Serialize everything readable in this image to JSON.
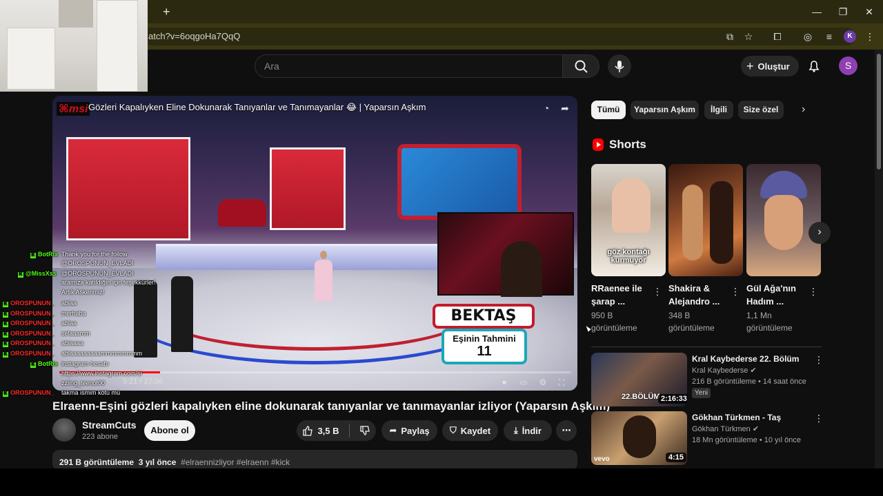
{
  "browser": {
    "url_fragment": "atch?v=6oqgoHa7QqQ",
    "profile_initial": "K",
    "new_tab_glyph": "+",
    "minimize_glyph": "—",
    "maximize_glyph": "❐",
    "close_glyph": "✕"
  },
  "header": {
    "search_placeholder": "Ara",
    "create_label": "Oluştur",
    "avatar_initial": "S"
  },
  "player": {
    "overlay_title": "Gözleri Kapalıyken Eline Dokunarak Tanıyanlar ve Tanımayanlar 😂 | Yaparsın Aşkım",
    "logo_text": "msi",
    "time": "5:21 / 27:06",
    "progress_fraction": 0.197,
    "bektas_label": "BEKTAŞ",
    "guess_label": "Eşinin Tahmini",
    "guess_value": "11",
    "chat": [
      {
        "user": "BotRix",
        "msg": "Thank you for the follow",
        "user_color": "#53fc18"
      },
      {
        "user": "",
        "msg": "@OROSPUNUN_EVLADI",
        "user_color": "#53fc18"
      },
      {
        "user": "@MissXss",
        "msg": "@OROSPUNUN_EVLADI",
        "user_color": "#53fc18"
      },
      {
        "user": "",
        "msg": "aramıza katıldığın için teşekkürler!",
        "user_color": "#53fc18"
      },
      {
        "user": "",
        "msg": "Artık Askerimiz!",
        "user_color": "#53fc18"
      },
      {
        "user": "OROSPUNUN_",
        "msg": "ablaa",
        "user_color": "#ff2a2a"
      },
      {
        "user": "OROSPUNUN_",
        "msg": "merhaba",
        "user_color": "#ff2a2a"
      },
      {
        "user": "OROSPUNUN_",
        "msg": "ablaa",
        "user_color": "#ff2a2a"
      },
      {
        "user": "OROSPUNUN_",
        "msg": "selaaamm",
        "user_color": "#ff2a2a"
      },
      {
        "user": "OROSPUNUN_",
        "msg": "ablaaaa",
        "user_color": "#ff2a2a"
      },
      {
        "user": "OROSPUNUN_",
        "msg": "ablaaaaaaaaammmmmmmm",
        "user_color": "#ff2a2a"
      },
      {
        "user": "BotRix",
        "msg": "instagram hesabı",
        "user_color": "#53fc18"
      },
      {
        "user": "",
        "msg": "https://www.instagram.com/si",
        "user_color": "#53fc18"
      },
      {
        "user": "",
        "msg": "zzling_teenot00",
        "user_color": "#53fc18"
      },
      {
        "user": "OROSPUNUN_",
        "msg": "takma ismim kötü mü",
        "user_color": "#ff2a2a"
      }
    ]
  },
  "video": {
    "title": "Elraenn-Eşini gözleri kapalıyken eline dokunarak tanıyanlar ve tanımayanlar izliyor (Yaparsın Aşkım)",
    "channel": "StreamCuts",
    "subscribers": "223 abone",
    "subscribe_label": "Abone ol",
    "likes": "3,5 B",
    "share_label": "Paylaş",
    "save_label": "Kaydet",
    "download_label": "İndir",
    "more_glyph": "⋯",
    "views": "291 B görüntüleme",
    "age": "3 yıl önce",
    "tags": "#elraennizliyor #elraenn #kick"
  },
  "chips": [
    {
      "label": "Tümü",
      "active": true
    },
    {
      "label": "Yaparsın Aşkım",
      "active": false
    },
    {
      "label": "İlgili",
      "active": false
    },
    {
      "label": "Size özel",
      "active": false
    }
  ],
  "shorts": {
    "heading": "Shorts",
    "items": [
      {
        "title": "RRaenee ile şarap ...",
        "views": "950 B görüntüleme",
        "caption": "göz kontağı kurmuyor"
      },
      {
        "title": "Shakira & Alejandro ...",
        "views": "348 B görüntüleme",
        "caption": ""
      },
      {
        "title": "Gül Ağa'nın Hadım ...",
        "views": "1,1 Mn görüntüleme",
        "caption": ""
      }
    ]
  },
  "recommendations": [
    {
      "title": "Kral Kaybederse 22. Bölüm",
      "channel": "Kral Kaybederse",
      "meta": "216 B görüntüleme • 14 saat önce",
      "duration": "2:16:33",
      "badge": "Yeni",
      "thumb_text": "22.BÖLÜM"
    },
    {
      "title": "Gökhan Türkmen - Taş",
      "channel": "Gökhan Türkmen",
      "meta": "18 Mn görüntüleme • 10 yıl önce",
      "duration": "4:15",
      "badge": "",
      "thumb_text": "vevo"
    }
  ],
  "colors": {
    "accent_red": "#ff0000",
    "kick_green": "#53fc18",
    "background": "#0f0f0f"
  }
}
